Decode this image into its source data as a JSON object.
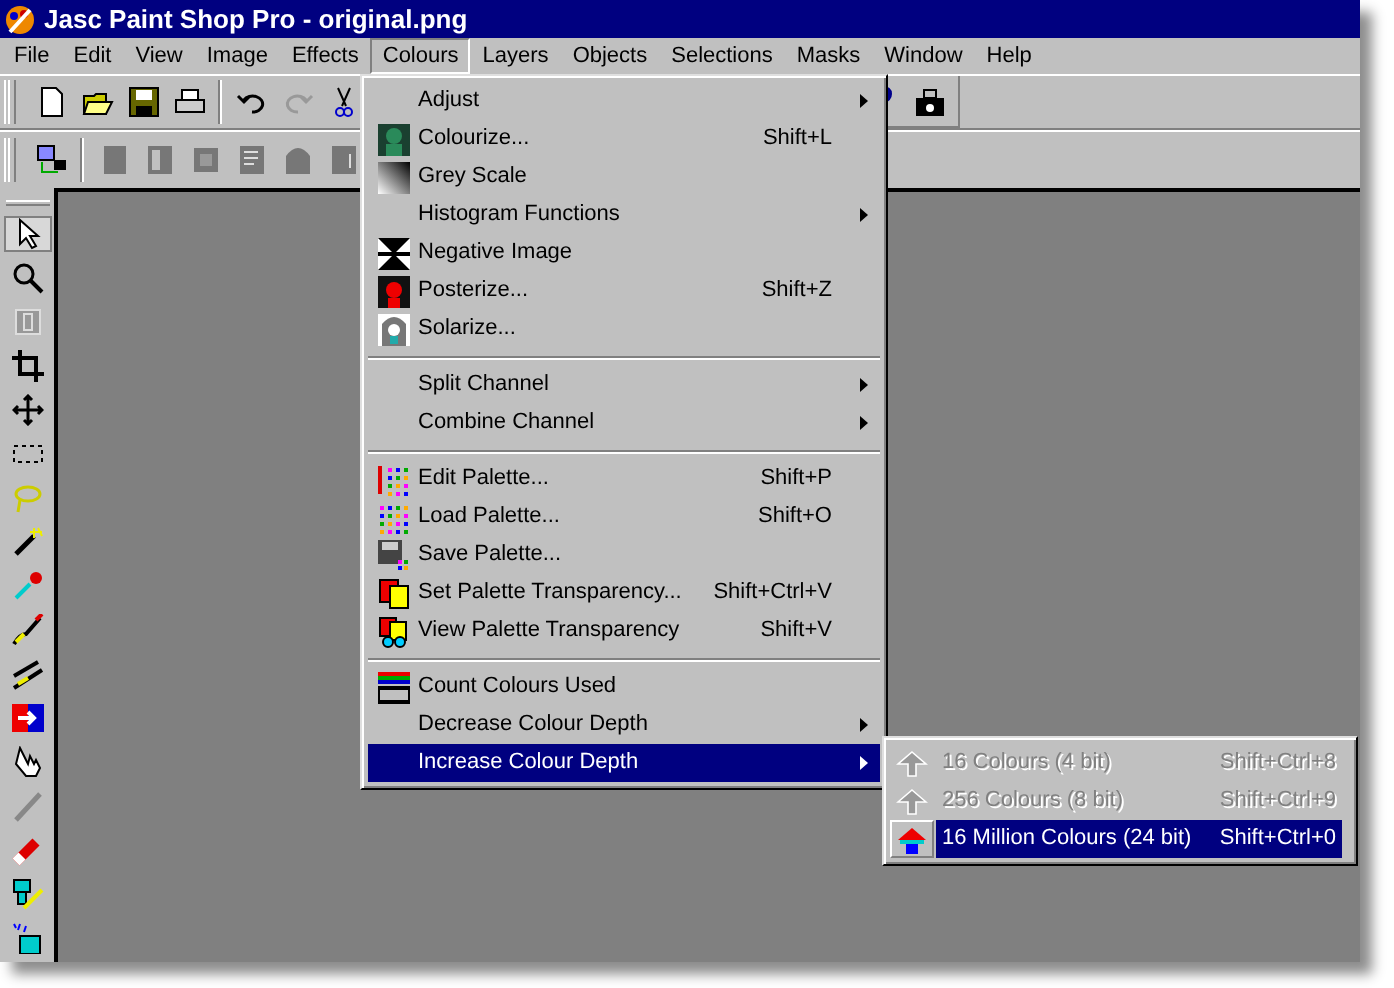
{
  "window": {
    "title": "Jasc Paint Shop Pro - original.png"
  },
  "menu_bar": [
    {
      "label": "File",
      "selected": false
    },
    {
      "label": "Edit",
      "selected": false
    },
    {
      "label": "View",
      "selected": false
    },
    {
      "label": "Image",
      "selected": false
    },
    {
      "label": "Effects",
      "selected": false
    },
    {
      "label": "Colours",
      "selected": true
    },
    {
      "label": "Layers",
      "selected": false
    },
    {
      "label": "Objects",
      "selected": false
    },
    {
      "label": "Selections",
      "selected": false
    },
    {
      "label": "Masks",
      "selected": false
    },
    {
      "label": "Window",
      "selected": false
    },
    {
      "label": "Help",
      "selected": false
    }
  ],
  "colours_menu": [
    {
      "kind": "item",
      "label": "Adjust",
      "submenu": true,
      "selected": false
    },
    {
      "kind": "item",
      "label": "Colourize...",
      "shortcut": "Shift+L",
      "submenu": false,
      "selected": false
    },
    {
      "kind": "item",
      "label": "Grey Scale",
      "submenu": false,
      "selected": false
    },
    {
      "kind": "item",
      "label": "Histogram Functions",
      "submenu": true,
      "selected": false
    },
    {
      "kind": "item",
      "label": "Negative Image",
      "submenu": false,
      "selected": false
    },
    {
      "kind": "item",
      "label": "Posterize...",
      "shortcut": "Shift+Z",
      "submenu": false,
      "selected": false
    },
    {
      "kind": "item",
      "label": "Solarize...",
      "submenu": false,
      "selected": false
    },
    {
      "kind": "separator"
    },
    {
      "kind": "item",
      "label": "Split Channel",
      "submenu": true,
      "selected": false
    },
    {
      "kind": "item",
      "label": "Combine Channel",
      "submenu": true,
      "selected": false
    },
    {
      "kind": "separator"
    },
    {
      "kind": "item",
      "label": "Edit Palette...",
      "shortcut": "Shift+P",
      "submenu": false,
      "selected": false
    },
    {
      "kind": "item",
      "label": "Load Palette...",
      "shortcut": "Shift+O",
      "submenu": false,
      "selected": false
    },
    {
      "kind": "item",
      "label": "Save Palette...",
      "submenu": false,
      "selected": false
    },
    {
      "kind": "item",
      "label": "Set Palette Transparency...",
      "shortcut": "Shift+Ctrl+V",
      "submenu": false,
      "selected": false
    },
    {
      "kind": "item",
      "label": "View Palette Transparency",
      "shortcut": "Shift+V",
      "submenu": false,
      "selected": false
    },
    {
      "kind": "separator"
    },
    {
      "kind": "item",
      "label": "Count Colours Used",
      "submenu": false,
      "selected": false
    },
    {
      "kind": "item",
      "label": "Decrease Colour Depth",
      "submenu": true,
      "selected": false
    },
    {
      "kind": "item",
      "label": "Increase Colour Depth",
      "submenu": true,
      "selected": true
    }
  ],
  "colour_depth_submenu": [
    {
      "label": "16 Colours (4 bit)",
      "shortcut": "Shift+Ctrl+8",
      "disabled": true,
      "selected": false
    },
    {
      "label": "256 Colours (8 bit)",
      "shortcut": "Shift+Ctrl+9",
      "disabled": true,
      "selected": false
    },
    {
      "label": "16 Million Colours (24 bit)",
      "shortcut": "Shift+Ctrl+0",
      "disabled": false,
      "selected": true
    }
  ]
}
